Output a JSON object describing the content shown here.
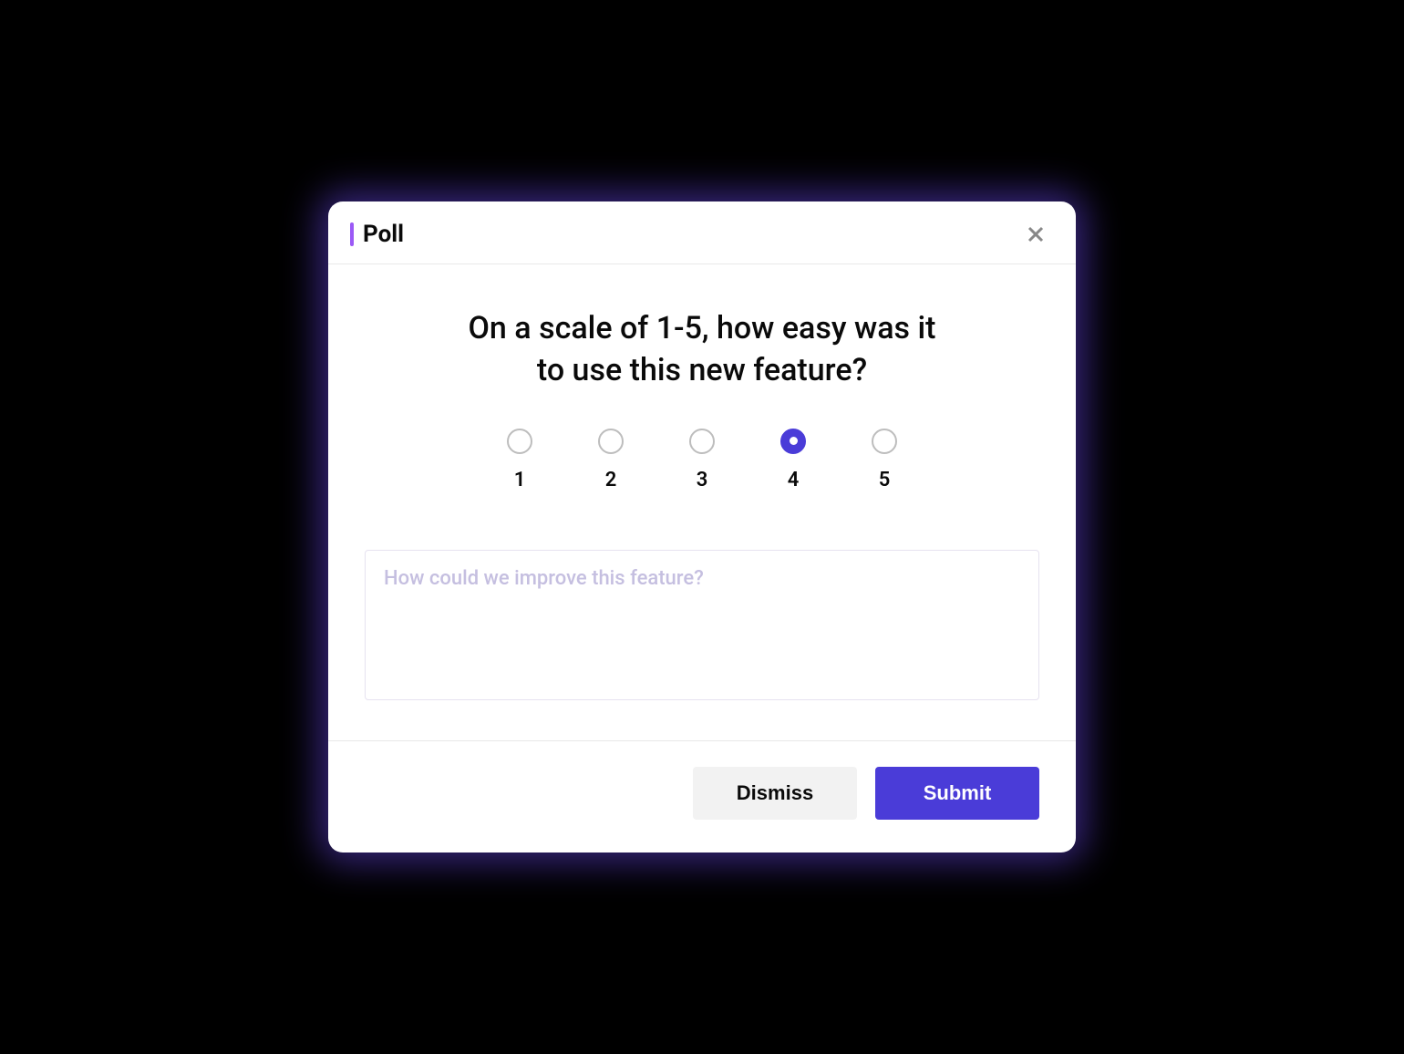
{
  "header": {
    "title": "Poll"
  },
  "body": {
    "question": "On a scale of 1-5, how easy was it to use this new feature?",
    "rating": {
      "options": [
        "1",
        "2",
        "3",
        "4",
        "5"
      ],
      "selected_index": 3
    },
    "feedback_placeholder": "How could we improve this feature?"
  },
  "footer": {
    "dismiss_label": "Dismiss",
    "submit_label": "Submit"
  },
  "colors": {
    "accent": "#4a3cd8",
    "accent_bar": "#9b59f6"
  }
}
